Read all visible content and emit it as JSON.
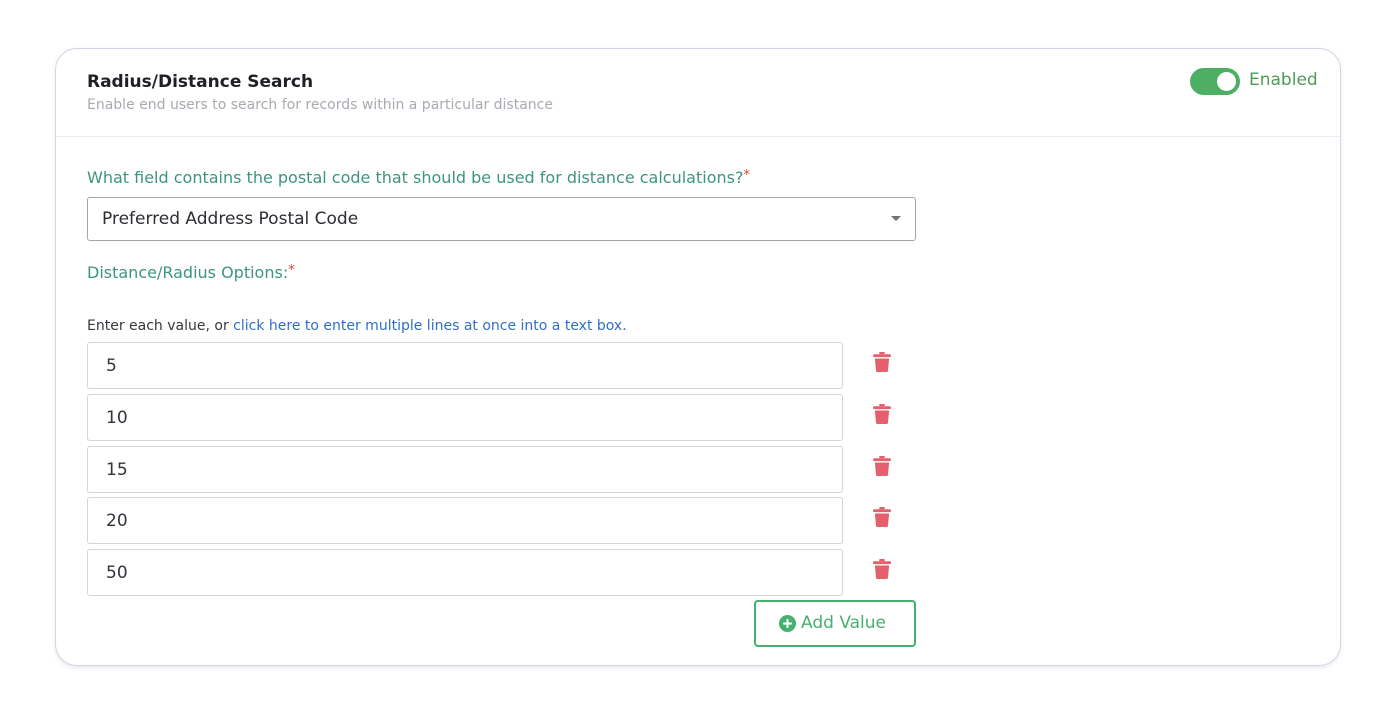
{
  "card": {
    "title": "Radius/Distance Search",
    "subtitle": "Enable end users to search for records within a particular distance",
    "toggle": {
      "label": "Enabled",
      "on": true,
      "color": "#4caf63"
    }
  },
  "postal_field": {
    "label": "What field contains the postal code that should be used for distance calculations?",
    "required_mark": "*",
    "selected": "Preferred Address Postal Code"
  },
  "distance_options": {
    "label": "Distance/Radius Options:",
    "required_mark": "*",
    "hint_prefix": "Enter each value, or ",
    "hint_link": "click here to enter multiple lines at once into a text box.",
    "values": [
      "5",
      "10",
      "15",
      "20",
      "50"
    ],
    "delete_icon": "trash-icon",
    "delete_color": "#e4606d"
  },
  "add_button": {
    "label": "Add Value",
    "icon": "plus-circle-icon",
    "color": "#46b06f"
  }
}
